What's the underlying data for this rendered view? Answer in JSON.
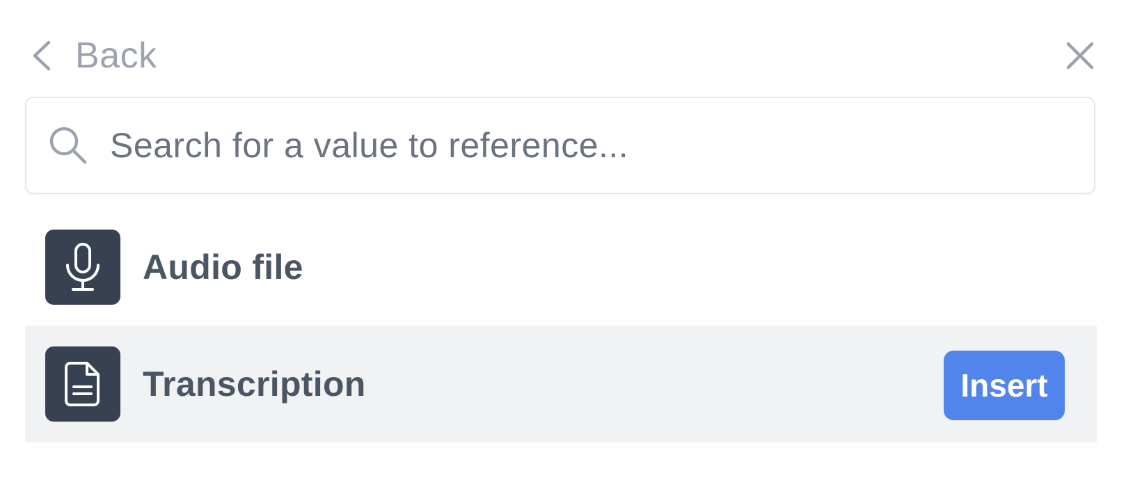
{
  "header": {
    "back_label": "Back",
    "back_icon": "chevron-left-icon",
    "close_icon": "close-icon"
  },
  "search": {
    "value": "",
    "placeholder": "Search for a value to reference...",
    "icon": "search-icon"
  },
  "items": [
    {
      "label": "Audio file",
      "icon": "microphone-icon",
      "selected": false
    },
    {
      "label": "Transcription",
      "icon": "document-icon",
      "selected": true
    }
  ],
  "actions": {
    "insert_label": "Insert"
  },
  "colors": {
    "muted_text": "#9ca3af",
    "placeholder": "#6b7280",
    "icon_bg": "#374151",
    "item_text": "#4b5563",
    "selected_row_bg": "#f1f2f4",
    "accent": "#5185ec",
    "border": "#e5e7eb"
  }
}
